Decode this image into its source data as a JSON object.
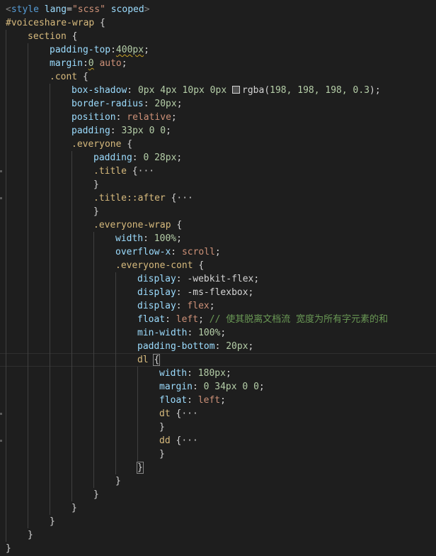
{
  "editor": {
    "lines": [
      {
        "indent": 0,
        "tokens": [
          {
            "t": "<",
            "c": "tag"
          },
          {
            "t": "style",
            "c": "tagname"
          },
          {
            "t": " ",
            "c": "punc"
          },
          {
            "t": "lang",
            "c": "attr"
          },
          {
            "t": "=",
            "c": "punc"
          },
          {
            "t": "\"scss\"",
            "c": "str"
          },
          {
            "t": " ",
            "c": "punc"
          },
          {
            "t": "scoped",
            "c": "attr"
          },
          {
            "t": ">",
            "c": "tag"
          }
        ]
      },
      {
        "indent": 0,
        "tokens": [
          {
            "t": "#voiceshare-wrap",
            "c": "sel"
          },
          {
            "t": " {",
            "c": "punc"
          }
        ]
      },
      {
        "indent": 1,
        "tokens": [
          {
            "t": "section",
            "c": "sel"
          },
          {
            "t": " {",
            "c": "punc"
          }
        ]
      },
      {
        "indent": 2,
        "tokens": [
          {
            "t": "padding-top",
            "c": "prop"
          },
          {
            "t": ":",
            "c": "punc"
          },
          {
            "t": "400px",
            "c": "num squig"
          },
          {
            "t": ";",
            "c": "punc"
          }
        ]
      },
      {
        "indent": 2,
        "tokens": [
          {
            "t": "margin",
            "c": "prop"
          },
          {
            "t": ":",
            "c": "punc"
          },
          {
            "t": "0",
            "c": "num squig"
          },
          {
            "t": " auto",
            "c": "kw"
          },
          {
            "t": ";",
            "c": "punc"
          }
        ]
      },
      {
        "indent": 2,
        "tokens": [
          {
            "t": ".cont",
            "c": "sel"
          },
          {
            "t": " {",
            "c": "punc"
          }
        ]
      },
      {
        "indent": 3,
        "tokens": [
          {
            "t": "box-shadow",
            "c": "prop"
          },
          {
            "t": ": ",
            "c": "punc"
          },
          {
            "t": "0px 4px 10px 0px ",
            "c": "num"
          },
          {
            "t": "",
            "c": "swatch"
          },
          {
            "t": "rgba",
            "c": "punc"
          },
          {
            "t": "(",
            "c": "punc"
          },
          {
            "t": "198, 198, 198, 0.3",
            "c": "num"
          },
          {
            "t": ");",
            "c": "punc"
          }
        ]
      },
      {
        "indent": 3,
        "tokens": [
          {
            "t": "border-radius",
            "c": "prop"
          },
          {
            "t": ": ",
            "c": "punc"
          },
          {
            "t": "20px",
            "c": "num"
          },
          {
            "t": ";",
            "c": "punc"
          }
        ]
      },
      {
        "indent": 3,
        "tokens": [
          {
            "t": "position",
            "c": "prop"
          },
          {
            "t": ": ",
            "c": "punc"
          },
          {
            "t": "relative",
            "c": "kw"
          },
          {
            "t": ";",
            "c": "punc"
          }
        ]
      },
      {
        "indent": 3,
        "tokens": [
          {
            "t": "padding",
            "c": "prop"
          },
          {
            "t": ": ",
            "c": "punc"
          },
          {
            "t": "33px 0 0",
            "c": "num"
          },
          {
            "t": ";",
            "c": "punc"
          }
        ]
      },
      {
        "indent": 3,
        "tokens": [
          {
            "t": ".everyone",
            "c": "sel"
          },
          {
            "t": " {",
            "c": "punc"
          }
        ]
      },
      {
        "indent": 4,
        "tokens": [
          {
            "t": "padding",
            "c": "prop"
          },
          {
            "t": ": ",
            "c": "punc"
          },
          {
            "t": "0 28px",
            "c": "num"
          },
          {
            "t": ";",
            "c": "punc"
          }
        ]
      },
      {
        "indent": 4,
        "fold": true,
        "tokens": [
          {
            "t": ".title",
            "c": "sel"
          },
          {
            "t": " {",
            "c": "punc"
          },
          {
            "t": "···",
            "c": "fold"
          }
        ]
      },
      {
        "indent": 4,
        "tokens": [
          {
            "t": "}",
            "c": "punc"
          }
        ]
      },
      {
        "indent": 4,
        "fold": true,
        "tokens": [
          {
            "t": ".title::after",
            "c": "sel"
          },
          {
            "t": " {",
            "c": "punc"
          },
          {
            "t": "···",
            "c": "fold"
          }
        ]
      },
      {
        "indent": 4,
        "tokens": [
          {
            "t": "}",
            "c": "punc"
          }
        ]
      },
      {
        "indent": 4,
        "tokens": [
          {
            "t": ".everyone-wrap",
            "c": "sel"
          },
          {
            "t": " {",
            "c": "punc"
          }
        ]
      },
      {
        "indent": 5,
        "tokens": [
          {
            "t": "width",
            "c": "prop"
          },
          {
            "t": ": ",
            "c": "punc"
          },
          {
            "t": "100%",
            "c": "num"
          },
          {
            "t": ";",
            "c": "punc"
          }
        ]
      },
      {
        "indent": 5,
        "tokens": [
          {
            "t": "overflow-x",
            "c": "prop"
          },
          {
            "t": ": ",
            "c": "punc"
          },
          {
            "t": "scroll",
            "c": "kw"
          },
          {
            "t": ";",
            "c": "punc"
          }
        ]
      },
      {
        "indent": 5,
        "tokens": [
          {
            "t": ".everyone-cont",
            "c": "sel"
          },
          {
            "t": " {",
            "c": "punc"
          }
        ]
      },
      {
        "indent": 6,
        "tokens": [
          {
            "t": "display",
            "c": "prop"
          },
          {
            "t": ": ",
            "c": "punc"
          },
          {
            "t": "-webkit-flex",
            "c": "punc"
          },
          {
            "t": ";",
            "c": "punc"
          }
        ]
      },
      {
        "indent": 6,
        "tokens": [
          {
            "t": "display",
            "c": "prop"
          },
          {
            "t": ": ",
            "c": "punc"
          },
          {
            "t": "-ms-flexbox",
            "c": "punc"
          },
          {
            "t": ";",
            "c": "punc"
          }
        ]
      },
      {
        "indent": 6,
        "tokens": [
          {
            "t": "display",
            "c": "prop"
          },
          {
            "t": ": ",
            "c": "punc"
          },
          {
            "t": "flex",
            "c": "kw"
          },
          {
            "t": ";",
            "c": "punc"
          }
        ]
      },
      {
        "indent": 6,
        "tokens": [
          {
            "t": "float",
            "c": "prop"
          },
          {
            "t": ": ",
            "c": "punc"
          },
          {
            "t": "left",
            "c": "kw"
          },
          {
            "t": "; ",
            "c": "punc"
          },
          {
            "t": "// 使其脱离文档流 宽度为所有字元素的和",
            "c": "cmt"
          }
        ]
      },
      {
        "indent": 6,
        "tokens": [
          {
            "t": "min-width",
            "c": "prop"
          },
          {
            "t": ": ",
            "c": "punc"
          },
          {
            "t": "100%",
            "c": "num"
          },
          {
            "t": ";",
            "c": "punc"
          }
        ]
      },
      {
        "indent": 6,
        "tokens": [
          {
            "t": "padding-bottom",
            "c": "prop"
          },
          {
            "t": ": ",
            "c": "punc"
          },
          {
            "t": "20px",
            "c": "num"
          },
          {
            "t": ";",
            "c": "punc"
          }
        ]
      },
      {
        "indent": 6,
        "active": true,
        "tokens": [
          {
            "t": "dl",
            "c": "sel"
          },
          {
            "t": " ",
            "c": "punc"
          },
          {
            "t": "{",
            "c": "punc bracket-hl"
          }
        ]
      },
      {
        "indent": 7,
        "tokens": [
          {
            "t": "width",
            "c": "prop"
          },
          {
            "t": ": ",
            "c": "punc"
          },
          {
            "t": "180px",
            "c": "num"
          },
          {
            "t": ";",
            "c": "punc"
          }
        ]
      },
      {
        "indent": 7,
        "tokens": [
          {
            "t": "margin",
            "c": "prop"
          },
          {
            "t": ": ",
            "c": "punc"
          },
          {
            "t": "0 34px 0 0",
            "c": "num"
          },
          {
            "t": ";",
            "c": "punc"
          }
        ]
      },
      {
        "indent": 7,
        "tokens": [
          {
            "t": "float",
            "c": "prop"
          },
          {
            "t": ": ",
            "c": "punc"
          },
          {
            "t": "left",
            "c": "kw"
          },
          {
            "t": ";",
            "c": "punc"
          }
        ]
      },
      {
        "indent": 7,
        "fold": true,
        "tokens": [
          {
            "t": "dt",
            "c": "sel"
          },
          {
            "t": " {",
            "c": "punc"
          },
          {
            "t": "···",
            "c": "fold"
          }
        ]
      },
      {
        "indent": 7,
        "tokens": [
          {
            "t": "}",
            "c": "punc"
          }
        ]
      },
      {
        "indent": 7,
        "fold": true,
        "tokens": [
          {
            "t": "dd",
            "c": "sel"
          },
          {
            "t": " {",
            "c": "punc"
          },
          {
            "t": "···",
            "c": "fold"
          }
        ]
      },
      {
        "indent": 7,
        "tokens": [
          {
            "t": "}",
            "c": "punc"
          }
        ]
      },
      {
        "indent": 6,
        "tokens": [
          {
            "t": "}",
            "c": "punc bracket-hl"
          }
        ]
      },
      {
        "indent": 5,
        "tokens": [
          {
            "t": "}",
            "c": "punc"
          }
        ]
      },
      {
        "indent": 4,
        "tokens": [
          {
            "t": "}",
            "c": "punc"
          }
        ]
      },
      {
        "indent": 3,
        "tokens": [
          {
            "t": "}",
            "c": "punc"
          }
        ]
      },
      {
        "indent": 2,
        "tokens": [
          {
            "t": "}",
            "c": "punc"
          }
        ]
      },
      {
        "indent": 1,
        "tokens": [
          {
            "t": "}",
            "c": "punc"
          }
        ]
      },
      {
        "indent": 0,
        "tokens": [
          {
            "t": "}",
            "c": "punc"
          }
        ]
      }
    ]
  }
}
